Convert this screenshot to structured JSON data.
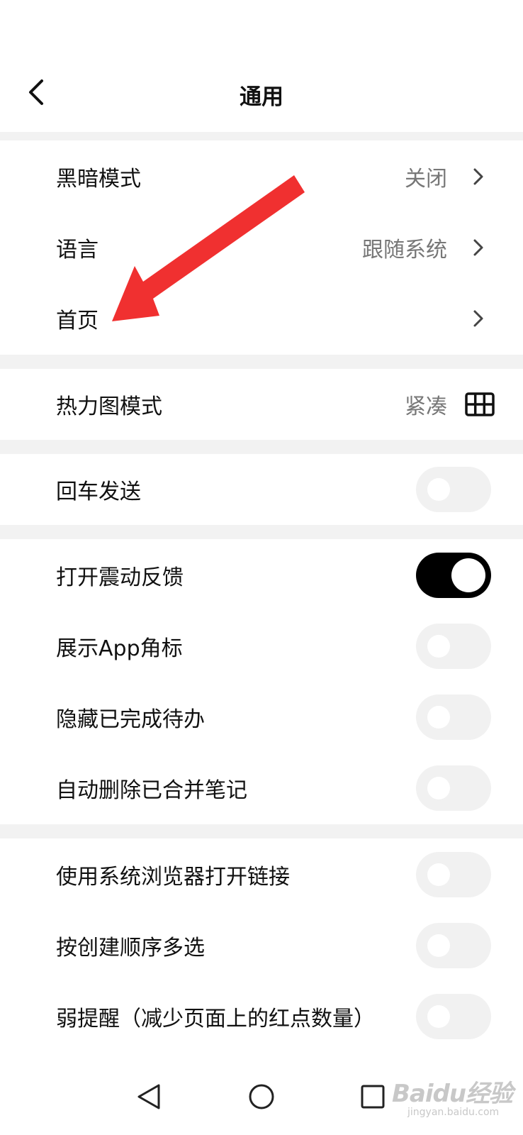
{
  "header": {
    "title": "通用"
  },
  "sections": [
    {
      "rows": [
        {
          "label": "黑暗模式",
          "value": "关闭"
        },
        {
          "label": "语言",
          "value": "跟随系统"
        },
        {
          "label": "首页",
          "value": ""
        }
      ]
    },
    {
      "rows": [
        {
          "label": "热力图模式",
          "value": "紧凑"
        }
      ]
    },
    {
      "rows": [
        {
          "label": "回车发送",
          "toggle": false
        }
      ]
    },
    {
      "rows": [
        {
          "label": "打开震动反馈",
          "toggle": true
        },
        {
          "label": "展示App角标",
          "toggle": false
        },
        {
          "label": "隐藏已完成待办",
          "toggle": false
        },
        {
          "label": "自动删除已合并笔记",
          "toggle": false
        }
      ]
    },
    {
      "rows": [
        {
          "label": "使用系统浏览器打开链接",
          "toggle": false
        },
        {
          "label": "按创建顺序多选",
          "toggle": false
        },
        {
          "label": "弱提醒（减少页面上的红点数量）",
          "toggle": false
        }
      ]
    }
  ],
  "annotation": {
    "color": "#f03030"
  },
  "watermark": {
    "main": "Baidu经验",
    "sub": "jingyan.baidu.com"
  },
  "colors": {
    "toggle_on": "#000000",
    "toggle_off": "#f1f1f1",
    "value_text": "#777777"
  }
}
